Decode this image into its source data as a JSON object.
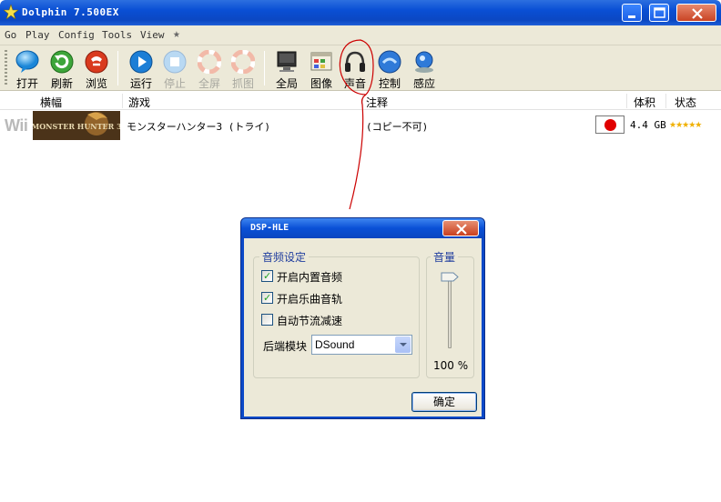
{
  "window": {
    "title": "Dolphin 7.500EX"
  },
  "menu": [
    "Go",
    "Play",
    "Config",
    "Tools",
    "View",
    "★"
  ],
  "toolbar": {
    "buttons": [
      {
        "label": "打开",
        "icon": "open-bubble-icon"
      },
      {
        "label": "刷新",
        "icon": "refresh-icon"
      },
      {
        "label": "浏览",
        "icon": "browse-icon"
      },
      {
        "label": "运行",
        "icon": "play-icon"
      },
      {
        "label": "停止",
        "icon": "stop-icon",
        "disabled": true
      },
      {
        "label": "全屏",
        "icon": "fullscreen-icon",
        "disabled": true
      },
      {
        "label": "抓图",
        "icon": "screenshot-icon",
        "disabled": true
      },
      {
        "label": "全局",
        "icon": "monitor-icon"
      },
      {
        "label": "图像",
        "icon": "graphics-icon"
      },
      {
        "label": "声音",
        "icon": "headphones-icon"
      },
      {
        "label": "控制",
        "icon": "controller-icon"
      },
      {
        "label": "感应",
        "icon": "wiimote-icon"
      }
    ]
  },
  "list": {
    "headers": {
      "banner": "横幅",
      "game": "游戏",
      "notes": "注释",
      "size": "体积",
      "state": "状态"
    },
    "rows": [
      {
        "platform": "Wii",
        "banner_text": "MONSTER HUNTER 3",
        "title": "モンスターハンター3 (トライ)",
        "notes": "(コピー不可)",
        "region": "Japan",
        "size": "4.4 GB",
        "rating": "★★★★★"
      }
    ]
  },
  "dialog": {
    "title": "DSP-HLE",
    "audio_group": "音频设定",
    "options": [
      {
        "label": "开启内置音频",
        "checked": true
      },
      {
        "label": "开启乐曲音轨",
        "checked": true
      },
      {
        "label": "自动节流减速",
        "checked": false
      }
    ],
    "backend_label": "后端模块",
    "backend_value": "DSound",
    "volume_group": "音量",
    "volume_value": "100 %",
    "volume_level": 1.0,
    "ok_label": "确定"
  },
  "colors": {
    "titlebar": "#0a4fd4",
    "annotation": "#cc0000",
    "face": "#ece9d8"
  }
}
